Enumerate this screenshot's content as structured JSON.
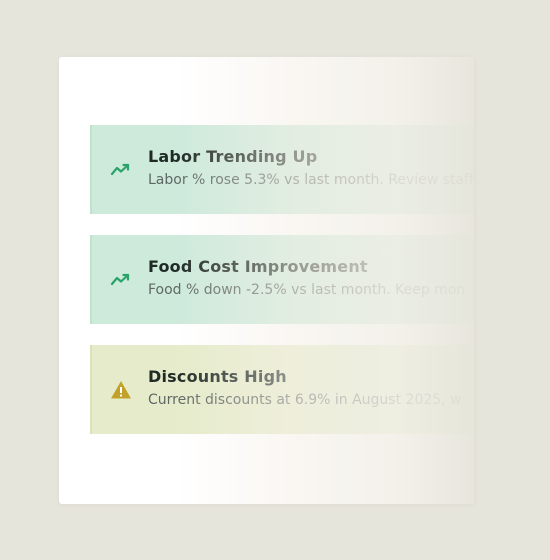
{
  "alerts": [
    {
      "type": "success",
      "icon": "trending-up-icon",
      "title": "Labor Trending Up",
      "message": "Labor % rose 5.3% vs last month. Review staff"
    },
    {
      "type": "success",
      "icon": "trending-up-icon",
      "title": "Food Cost Improvement",
      "message": "Food % down -2.5% vs last month. Keep mon"
    },
    {
      "type": "warning",
      "icon": "warning-icon",
      "title": "Discounts High",
      "message": "Current discounts at 6.9% in August 2025, w"
    }
  ],
  "colors": {
    "success_bg": "#cdeadb",
    "success_icon": "#2aa36b",
    "warning_bg": "#e6eccb",
    "warning_icon": "#c2a12a",
    "page_bg": "#e6e5db"
  }
}
